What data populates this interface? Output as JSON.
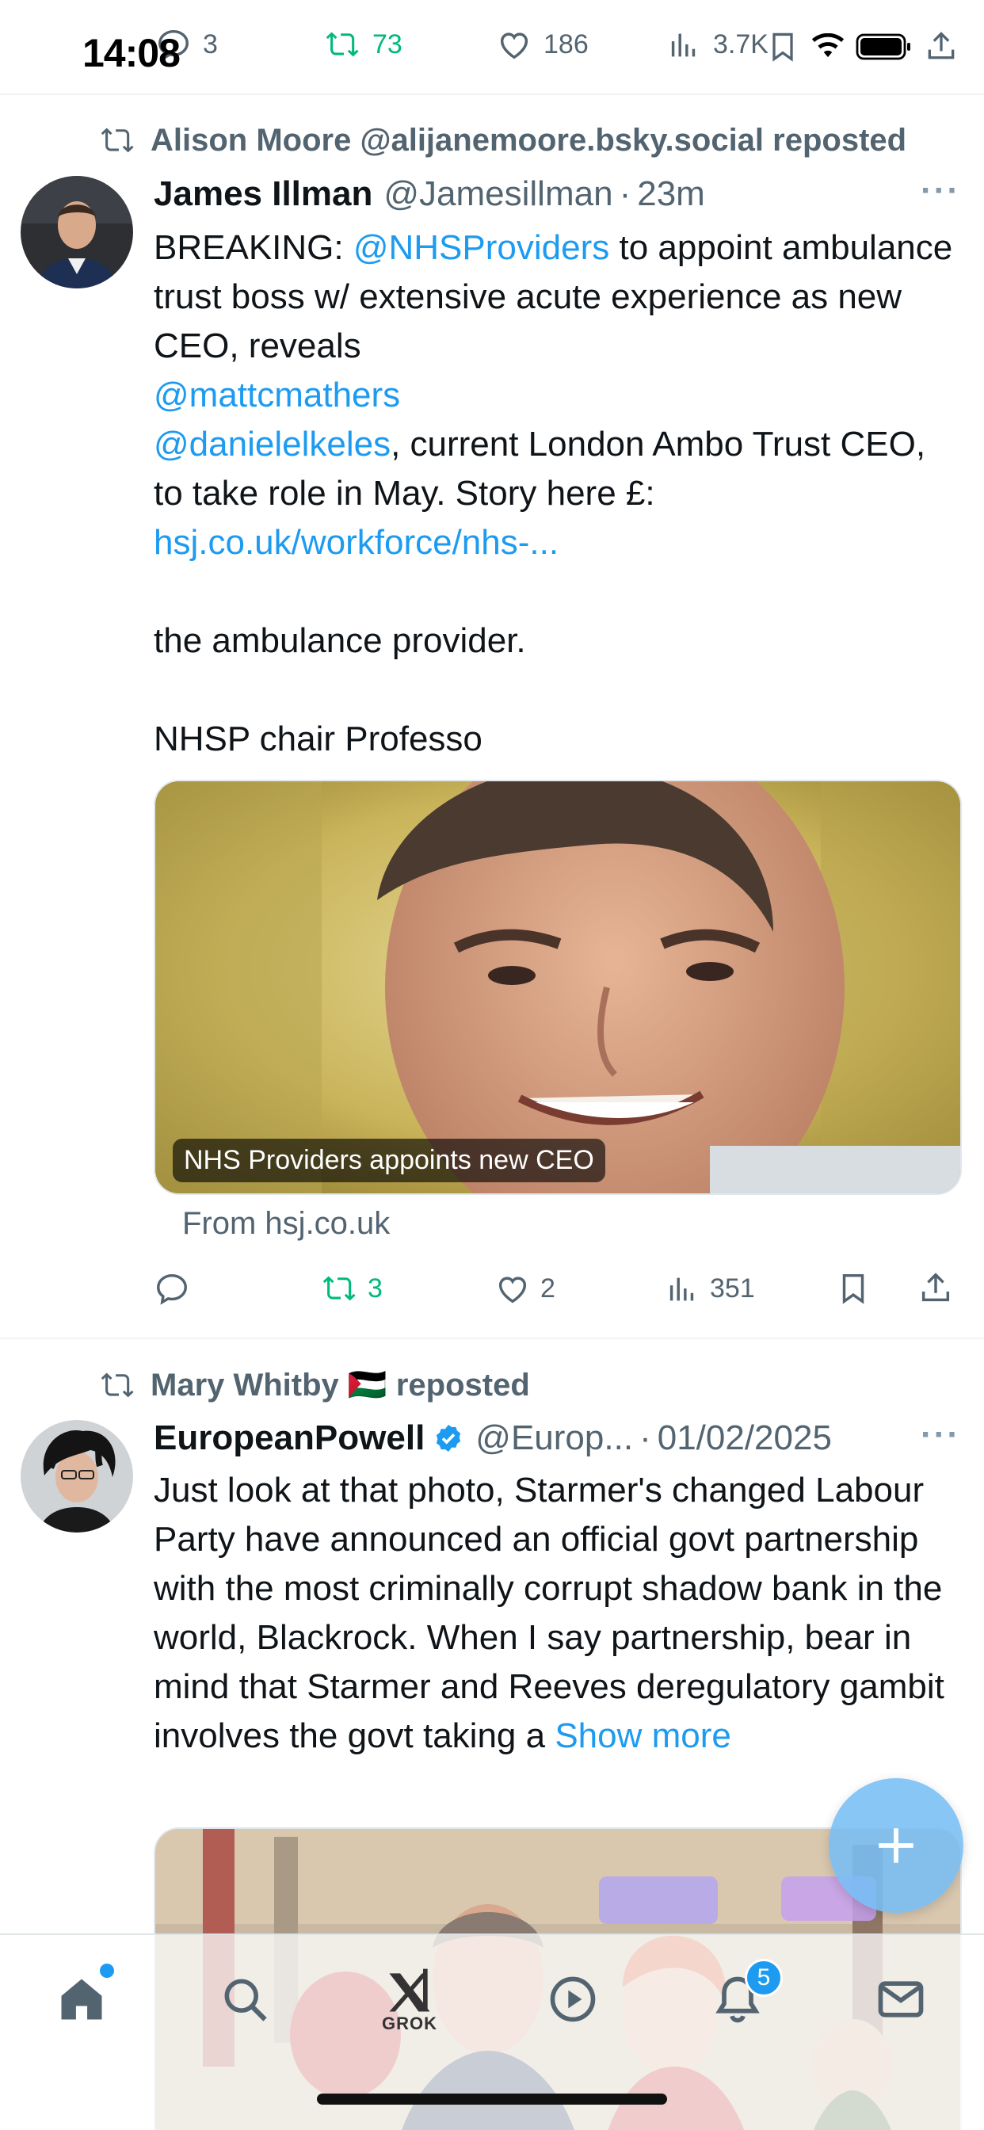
{
  "status_bar": {
    "time": "14:08"
  },
  "top_actions": {
    "replies": "3",
    "reposts": "73",
    "likes": "186",
    "views": "3.7K"
  },
  "posts": [
    {
      "repost_by": "Alison Moore @alijanemoore.bsky.social reposted",
      "author_name": "James Illman",
      "author_handle": "@Jamesillman",
      "time": "23m",
      "body": {
        "prefix": "BREAKING: ",
        "mention1": "@NHSProviders",
        "text1": " to appoint ambulance trust boss w/ extensive acute experience as new CEO, reveals",
        "mention2": "@mattcmathers",
        "mention3": "@danielelkeles",
        "text2": ", current London Ambo Trust CEO, to take role in May. Story here £:",
        "link": "hsj.co.uk/workforce/nhs-...",
        "para2": "the ambulance provider.",
        "para3": "NHSP chair Professo"
      },
      "media_caption": "NHS Providers appoints new CEO",
      "from_line": "From hsj.co.uk",
      "stats": {
        "replies": "",
        "reposts": "3",
        "likes": "2",
        "views": "351"
      }
    },
    {
      "repost_by": "Mary Whitby 🇵🇸 reposted",
      "author_name": "EuropeanPowell",
      "author_handle": "@Europ...",
      "time": "01/02/2025",
      "body": {
        "text": "Just look at that photo, Starmer's changed Labour Party have announced an official govt partnership with the most criminally corrupt shadow bank in the world, Blackrock. When I say partnership, bear in mind that Starmer and Reeves deregulatory gambit involves the govt taking a ",
        "show_more": "Show more"
      }
    }
  ],
  "bottom_nav": {
    "grok_label": "GROK",
    "notification_count": "5"
  },
  "colors": {
    "link": "#1d9bf0",
    "repost_green": "#00ba7c",
    "muted": "#536471"
  }
}
